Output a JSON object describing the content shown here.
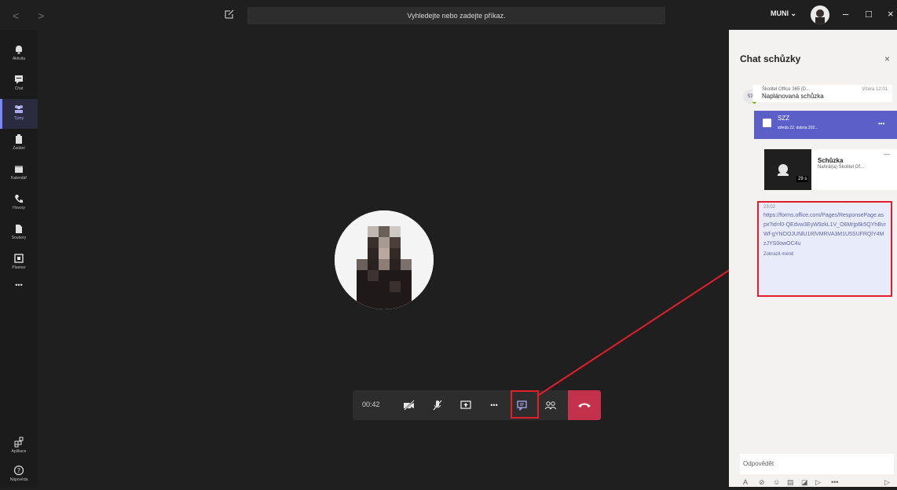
{
  "titlebar": {
    "nav": "< >",
    "search_placeholder": "Vyhledejte nebo zadejte příkaz.",
    "tenant": "MUNI",
    "tenant_chevron": "⌄",
    "minimize": "–",
    "maximize": "□",
    "close": "×"
  },
  "rail": {
    "items": [
      {
        "label": "Aktivita",
        "icon": "bell-icon"
      },
      {
        "label": "Chat",
        "icon": "chat-icon"
      },
      {
        "label": "Týmy",
        "icon": "teams-icon"
      },
      {
        "label": "Zadání",
        "icon": "assignments-icon"
      },
      {
        "label": "Kalendář",
        "icon": "calendar-icon"
      },
      {
        "label": "Hovory",
        "icon": "phone-icon"
      },
      {
        "label": "Soubory",
        "icon": "files-icon"
      },
      {
        "label": "Planner",
        "icon": "planner-icon"
      }
    ],
    "more": "•••",
    "bottom": [
      {
        "label": "Aplikace",
        "icon": "apps-icon"
      },
      {
        "label": "Nápověda",
        "icon": "help-icon"
      }
    ]
  },
  "call": {
    "timer": "00:42",
    "more": "•••"
  },
  "chat_panel": {
    "title": "Chat schůzky",
    "close": "×",
    "msg1": {
      "avatar": "S3",
      "author": "Školitel Office 365 (D...",
      "time": "Včera 12:01",
      "text": "Naplánovaná schůzka"
    },
    "meeting_card": {
      "title": "SZZ",
      "date": "středa 22. dubna 202...",
      "more": "•••"
    },
    "recording": {
      "title": "Schůzka",
      "subtitle": "Nahrál(a) Školitel Of...",
      "duration": "29 s",
      "more": "—"
    },
    "link_msg": {
      "time": "23:02",
      "url": "https://forms.office.com/Pages/ResponsePage.aspx?id=l0-QEdvw3EyW9zkL1V_O6Mrjp6k5QYhBvrWf-gYNOOJUNlU1RlVMRVA3M1U5SUFRQlY4MzJYS0owOC4u",
      "show_less": "Zobrazit méně"
    },
    "reply_placeholder": "Odpovědět"
  },
  "colors": {
    "accent": "#5b5fc7",
    "hangup": "#c4314b",
    "highlight": "#e01f2a"
  }
}
